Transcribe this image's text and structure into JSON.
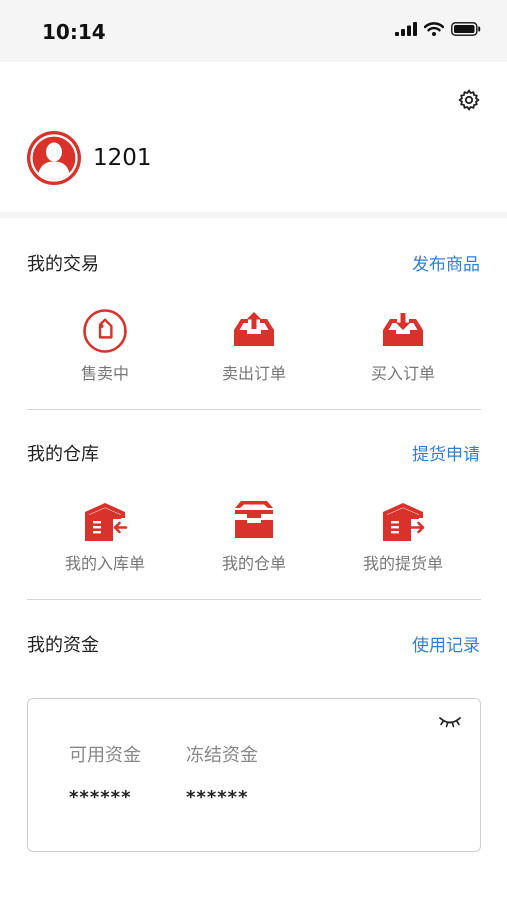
{
  "status": {
    "time": "10:14"
  },
  "profile": {
    "username": "1201"
  },
  "trade": {
    "title": "我的交易",
    "link": "发布商品",
    "items": [
      {
        "label": "售卖中",
        "icon": "price-tag-icon"
      },
      {
        "label": "卖出订单",
        "icon": "tray-upload-icon"
      },
      {
        "label": "买入订单",
        "icon": "tray-download-icon"
      }
    ]
  },
  "warehouse": {
    "title": "我的仓库",
    "link": "提货申请",
    "items": [
      {
        "label": "我的入库单",
        "icon": "warehouse-in-icon"
      },
      {
        "label": "我的仓单",
        "icon": "warehouse-receipt-icon"
      },
      {
        "label": "我的提货单",
        "icon": "warehouse-out-icon"
      }
    ]
  },
  "funds": {
    "title": "我的资金",
    "link": "使用记录",
    "available_label": "可用资金",
    "available_value": "******",
    "frozen_label": "冻结资金",
    "frozen_value": "******"
  },
  "colors": {
    "accent": "#d8322a",
    "link": "#2f7fd6"
  }
}
